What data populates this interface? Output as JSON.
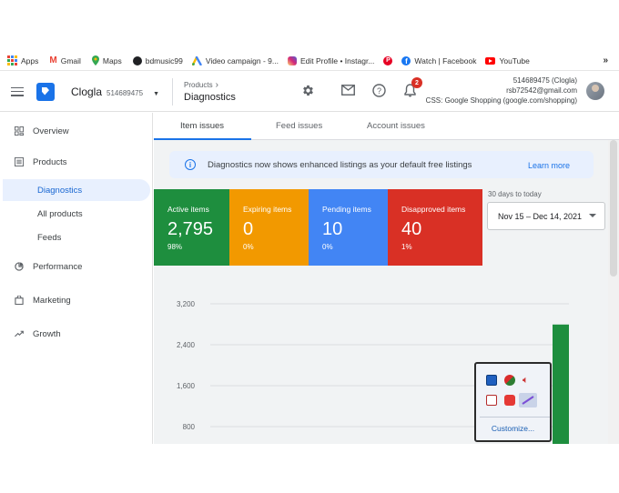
{
  "bookmarks": [
    {
      "label": "Apps",
      "icon": "apps-grid-icon",
      "color": "#ea4335"
    },
    {
      "label": "Gmail",
      "icon": "gmail-icon",
      "color": "#ea4335"
    },
    {
      "label": "Maps",
      "icon": "maps-pin-icon",
      "color": "#34a853"
    },
    {
      "label": "bdmusic99",
      "icon": "globe-icon",
      "color": "#202124"
    },
    {
      "label": "Video campaign - 9...",
      "icon": "google-ads-icon",
      "color": "#fbbc04"
    },
    {
      "label": "Edit Profile • Instagr...",
      "icon": "instagram-icon",
      "color": "#c13584"
    },
    {
      "label": "",
      "icon": "pinterest-icon",
      "color": "#e60023"
    },
    {
      "label": "Watch | Facebook",
      "icon": "facebook-icon",
      "color": "#1877f2"
    },
    {
      "label": "YouTube",
      "icon": "youtube-icon",
      "color": "#ff0000"
    }
  ],
  "bookmarks_more": "»",
  "appbar": {
    "account_name": "Clogla",
    "account_id": "514689475",
    "breadcrumb_parent": "Products",
    "breadcrumb_chevron": "›",
    "breadcrumb_current": "Diagnostics",
    "notification_count": "2",
    "account_line1": "514689475 (Clogla)",
    "account_line2": "rsb72542@gmail.com",
    "account_line3": "CSS: Google Shopping (google.com/shopping)"
  },
  "sidebar": {
    "items": [
      {
        "label": "Overview",
        "icon": "overview-icon"
      },
      {
        "label": "Products",
        "icon": "products-list-icon"
      },
      {
        "label": "Diagnostics",
        "active": true
      },
      {
        "label": "All products"
      },
      {
        "label": "Feeds"
      },
      {
        "label": "Performance",
        "icon": "performance-icon"
      },
      {
        "label": "Marketing",
        "icon": "marketing-bag-icon"
      },
      {
        "label": "Growth",
        "icon": "growth-trend-icon"
      }
    ]
  },
  "tabs": [
    "Item issues",
    "Feed issues",
    "Account issues"
  ],
  "banner": {
    "text": "Diagnostics now shows enhanced listings as your default free listings",
    "link": "Learn more"
  },
  "cards": [
    {
      "title": "Active items",
      "value": "2,795",
      "pct": "98%",
      "color": "#1e8e3e"
    },
    {
      "title": "Expiring items",
      "value": "0",
      "pct": "0%",
      "color": "#f29900"
    },
    {
      "title": "Pending items",
      "value": "10",
      "pct": "0%",
      "color": "#4285f4"
    },
    {
      "title": "Disapproved items",
      "value": "40",
      "pct": "1%",
      "color": "#d93025"
    }
  ],
  "date_range": {
    "label": "30 days to today",
    "value": "Nov 15 – Dec 14, 2021"
  },
  "chart_data": {
    "type": "bar",
    "y_ticks": [
      "3,200",
      "2,400",
      "1,600",
      "800"
    ],
    "ylim": [
      0,
      3200
    ],
    "visible_bar": {
      "value": 2795,
      "color": "#1e8e3e"
    }
  },
  "tray_popup": {
    "icons": [
      "network-icon",
      "antivirus-icon",
      "volume-icon",
      "security-center-icon",
      "recording-icon",
      "pen-tool-icon"
    ],
    "customize": "Customize..."
  }
}
